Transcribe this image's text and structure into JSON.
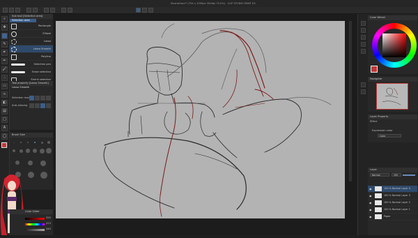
{
  "menu": [
    "File",
    "Edit",
    "Story(H)",
    "Animation",
    "Layer",
    "Select",
    "View",
    "Filter",
    "Window",
    "Help"
  ],
  "window_title": "Illustration1* (754 x 1090px 350dpi 75.0%) - CLIP STUDIO PAINT EX",
  "window_controls": [
    "–",
    "□",
    "✕"
  ],
  "canvas_tabs": [
    {
      "label": "Illustration1*",
      "active": true
    }
  ],
  "sub_tool": {
    "title": "Sub tool [Selection area]",
    "group_label": "Selection area",
    "items": [
      {
        "label": "Rectangle",
        "selected": false
      },
      {
        "label": "Ellipse",
        "selected": false
      },
      {
        "label": "Lasso",
        "selected": false
      },
      {
        "label": "Lasso Smooth",
        "selected": true
      },
      {
        "label": "Polyline",
        "selected": false
      },
      {
        "label": "Selection pen",
        "selected": false
      },
      {
        "label": "Erase selection",
        "selected": false
      },
      {
        "label": "Shrink selection",
        "selected": false
      }
    ]
  },
  "tool_property": {
    "title": "Tool property [Lasso Smooth]",
    "name": "Lasso Smooth",
    "selection_mode_label": "Selection mode",
    "anti_aliasing_label": "Anti-aliasing"
  },
  "brush_size": {
    "title": "Brush Size"
  },
  "color_slider": {
    "title": "Color Slider",
    "values": [
      "255",
      "223",
      "245"
    ]
  },
  "color_wheel": {
    "title": "Color Wheel",
    "main_color": "#c03a3a"
  },
  "navigator": {
    "title": "Navigator"
  },
  "layer_property": {
    "title": "Layer Property",
    "effect_label": "Effect",
    "expression_label": "Expression color",
    "expression_value": "Color"
  },
  "layers": {
    "title": "Layer",
    "blend_mode": "Normal",
    "opacity": "100",
    "items": [
      {
        "name": "100 % Normal\nLayer 4",
        "selected": true
      },
      {
        "name": "100 % Normal\nLayer 3",
        "selected": false
      },
      {
        "name": "100 % Normal\nLayer 2",
        "selected": false
      },
      {
        "name": "100 % Normal\nLayer 1",
        "selected": false
      },
      {
        "name": "Paper",
        "selected": false
      }
    ]
  },
  "colors": {
    "accent": "#3b5e8a",
    "canvas_gray": "#b3b3b3",
    "sketch_red": "#7a1a1a",
    "sketch_dark": "#2a2a2a"
  }
}
